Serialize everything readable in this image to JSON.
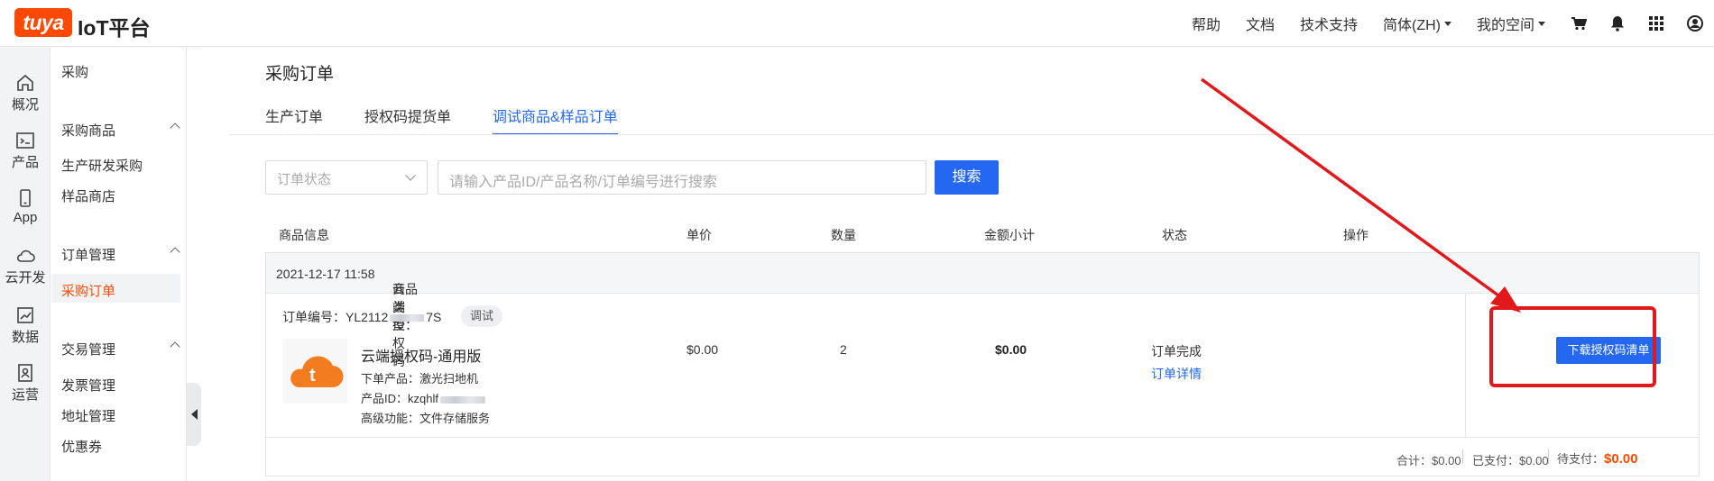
{
  "brand": {
    "badge": "tuya",
    "name": "IoT平台",
    "color": "#ff4800"
  },
  "topnav": {
    "help": "帮助",
    "docs": "文档",
    "support": "技术支持",
    "language": "简体(ZH)",
    "space": "我的空间",
    "icons": [
      "cart-icon",
      "bell-icon",
      "apps-grid-icon",
      "account-icon"
    ]
  },
  "rail": [
    {
      "icon": "home-icon",
      "label": "概况"
    },
    {
      "icon": "terminal-icon",
      "label": "产品"
    },
    {
      "icon": "phone-icon",
      "label": "App"
    },
    {
      "icon": "cloud-icon",
      "label": "云开发"
    },
    {
      "icon": "chart-icon",
      "label": "数据"
    },
    {
      "icon": "operation-icon",
      "label": "运营"
    }
  ],
  "menu": {
    "title": "采购",
    "group1": "采购商品",
    "group1_items": [
      "生产研发采购",
      "样品商店"
    ],
    "group2": "订单管理",
    "group2_active": "采购订单",
    "group3": "交易管理",
    "group3_items": [
      "发票管理",
      "地址管理",
      "优惠券"
    ]
  },
  "page": {
    "title": "采购订单",
    "tabs": [
      "生产订单",
      "授权码提货单",
      "调试商品&样品订单"
    ],
    "active_tab": 2
  },
  "filter": {
    "status_placeholder": "订单状态",
    "search_placeholder": "请输入产品ID/产品名称/订单编号进行搜索",
    "search_button": "搜索"
  },
  "table": {
    "headers": [
      "商品信息",
      "单价",
      "数量",
      "金额小计",
      "状态",
      "操作"
    ]
  },
  "order": {
    "datetime": "2021-12-17 11:58",
    "type_label": "商品类型：",
    "type_value": "云端授权码",
    "number_label": "订单编号：",
    "number_prefix": "YL2112",
    "number_suffix": "7S",
    "tag": "调试",
    "product_name": "云端授权码-通用版",
    "line1": "下单产品：激光扫地机",
    "line2_label": "产品ID：",
    "line2_value": "kzqhlf",
    "line3": "高级功能：文件存储服务",
    "unit_price": "$0.00",
    "quantity": "2",
    "subtotal": "$0.00",
    "status": "订单完成",
    "detail_link": "订单详情",
    "action_button": "下载授权码清单"
  },
  "totals": {
    "total_label": "合计：",
    "total_value": "$0.00",
    "paid_label": "已支付：",
    "paid_value": "$0.00",
    "due_label": "待支付：",
    "due_value": "$0.00"
  },
  "annotation_color": "#e1191c",
  "accent_color": "#2468f2"
}
